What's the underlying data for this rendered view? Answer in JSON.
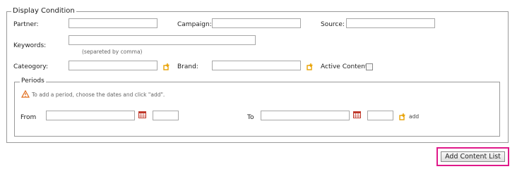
{
  "display_condition": {
    "legend": "Display Condition",
    "partner_label": "Partner:",
    "campaign_label": "Campaign:",
    "source_label": "Source:",
    "keywords_label": "Keywords:",
    "keywords_hint": "(separeted by comma)",
    "category_label": "Cateogory:",
    "brand_label": "Brand:",
    "active_content_label": "Active Content",
    "partner_value": "",
    "campaign_value": "",
    "source_value": "",
    "keywords_value": "",
    "category_value": "",
    "brand_value": ""
  },
  "periods": {
    "legend": "Periods",
    "hint": "To add a period, choose the dates and click \"add\".",
    "from_label": "From",
    "to_label": "To",
    "add_label": "add",
    "from_date": "",
    "from_time": "",
    "to_date": "",
    "to_time": ""
  },
  "actions": {
    "add_content_list_label": "Add Content List"
  },
  "colors": {
    "highlight_border": "#e0198a",
    "add_icon": "#e8a100",
    "warning_icon": "#e06a18",
    "calendar_icon": "#c0392b"
  },
  "icons": [
    "add-icon",
    "warning-icon",
    "calendar-icon"
  ]
}
